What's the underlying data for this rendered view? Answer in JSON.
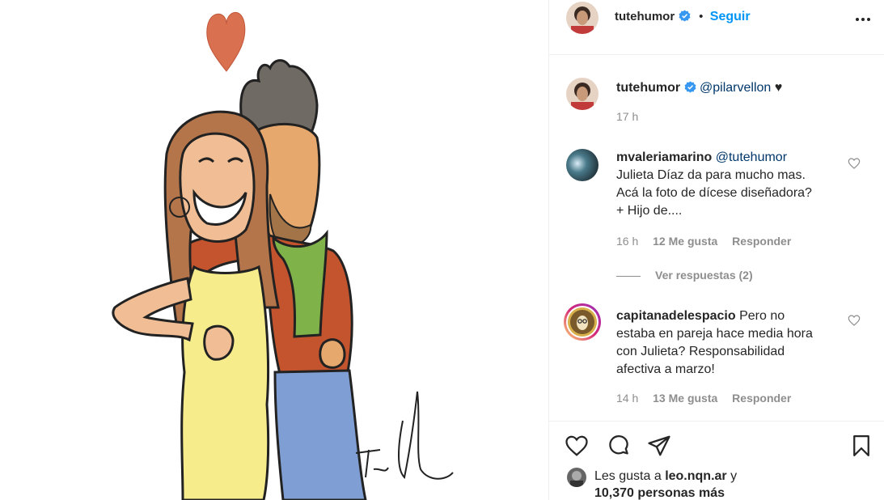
{
  "post": {
    "image_alt": "Caricatura de pareja abrazada",
    "signature": "Tute"
  },
  "header": {
    "username": "tutehumor",
    "separator": "•",
    "follow_label": "Seguir"
  },
  "caption": {
    "username": "tutehumor",
    "mention": "@pilarvellon",
    "emoji": "♥",
    "time": "17 h"
  },
  "comments": [
    {
      "username": "mvaleriamarino",
      "mention": "@tutehumor",
      "lines": [
        "Julieta Díaz da para mucho mas.",
        "Acá la foto de dícese diseñadora?",
        "+ Hijo de...."
      ],
      "time": "16 h",
      "likes": "12 Me gusta",
      "reply_label": "Responder",
      "view_replies": "Ver respuestas (2)"
    },
    {
      "username": "capitanadelespacio",
      "lines_first": "Pero no",
      "lines": [
        "estaba en pareja hace media hora",
        "con Julieta? Responsabilidad",
        "afectiva a marzo!"
      ],
      "time": "14 h",
      "likes": "13 Me gusta",
      "reply_label": "Responder"
    }
  ],
  "likes": {
    "prefix": "Les gusta a",
    "user": "leo.nqn.ar",
    "connector": "y",
    "count_text": "10,370 personas más"
  },
  "colors": {
    "accent": "#0095f6",
    "text": "#262626",
    "secondary": "#8e8e8e",
    "mention": "#00376b",
    "verified": "#3897f0"
  },
  "icons": [
    "more-options-icon",
    "verified-icon",
    "heart-icon",
    "comment-icon",
    "share-icon",
    "bookmark-icon"
  ]
}
